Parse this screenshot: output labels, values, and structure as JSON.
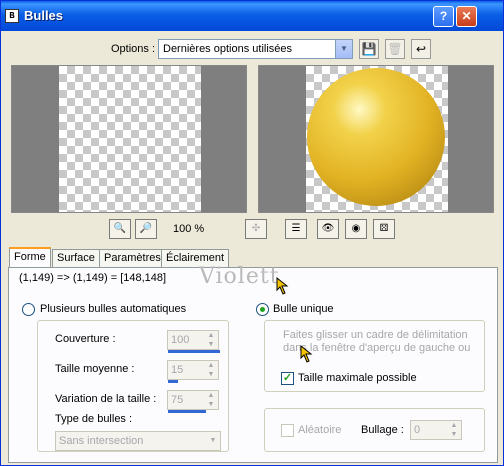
{
  "window": {
    "title": "Bulles",
    "app_icon": "bulles-app-icon"
  },
  "options": {
    "label": "Options :",
    "selected": "Dernières options utilisées"
  },
  "zoom": {
    "percent": "100 %"
  },
  "tabs": [
    {
      "label": "Forme",
      "active": true
    },
    {
      "label": "Surface",
      "active": false
    },
    {
      "label": "Paramètres",
      "active": false
    },
    {
      "label": "Éclairement",
      "active": false
    }
  ],
  "coords_text": "(1,149) => (1,149) = [148,148]",
  "watermark": "Violett",
  "auto": {
    "label": "Plusieurs bulles automatiques",
    "coverage": {
      "label": "Couverture :",
      "value": "100"
    },
    "avg_size": {
      "label": "Taille moyenne :",
      "value": "15"
    },
    "size_var": {
      "label": "Variation de la taille :",
      "value": "75"
    },
    "type": {
      "label": "Type de bulles :",
      "value": "Sans intersection"
    }
  },
  "single": {
    "label": "Bulle unique",
    "hint": "Faites glisser un cadre de délimitation dans la fenêtre d'aperçu de gauche ou",
    "max_size_label": "Taille maximale possible"
  },
  "random": {
    "label": "Aléatoire",
    "bullage_label": "Bullage :",
    "bullage_value": "0"
  },
  "colors": {
    "titlebar": "#0a5fe6",
    "ball": "#e2b223",
    "accent": "#3168d5"
  }
}
